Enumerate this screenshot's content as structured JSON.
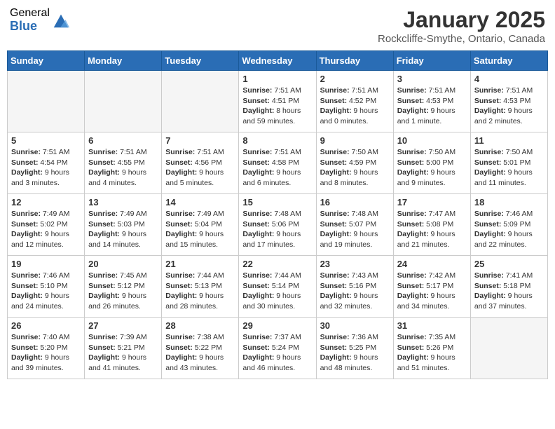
{
  "header": {
    "logo_general": "General",
    "logo_blue": "Blue",
    "title": "January 2025",
    "subtitle": "Rockcliffe-Smythe, Ontario, Canada"
  },
  "days_of_week": [
    "Sunday",
    "Monday",
    "Tuesday",
    "Wednesday",
    "Thursday",
    "Friday",
    "Saturday"
  ],
  "weeks": [
    [
      {
        "day": "",
        "info": ""
      },
      {
        "day": "",
        "info": ""
      },
      {
        "day": "",
        "info": ""
      },
      {
        "day": "1",
        "info": "Sunrise: 7:51 AM\nSunset: 4:51 PM\nDaylight: 8 hours and 59 minutes."
      },
      {
        "day": "2",
        "info": "Sunrise: 7:51 AM\nSunset: 4:52 PM\nDaylight: 9 hours and 0 minutes."
      },
      {
        "day": "3",
        "info": "Sunrise: 7:51 AM\nSunset: 4:53 PM\nDaylight: 9 hours and 1 minute."
      },
      {
        "day": "4",
        "info": "Sunrise: 7:51 AM\nSunset: 4:53 PM\nDaylight: 9 hours and 2 minutes."
      }
    ],
    [
      {
        "day": "5",
        "info": "Sunrise: 7:51 AM\nSunset: 4:54 PM\nDaylight: 9 hours and 3 minutes."
      },
      {
        "day": "6",
        "info": "Sunrise: 7:51 AM\nSunset: 4:55 PM\nDaylight: 9 hours and 4 minutes."
      },
      {
        "day": "7",
        "info": "Sunrise: 7:51 AM\nSunset: 4:56 PM\nDaylight: 9 hours and 5 minutes."
      },
      {
        "day": "8",
        "info": "Sunrise: 7:51 AM\nSunset: 4:58 PM\nDaylight: 9 hours and 6 minutes."
      },
      {
        "day": "9",
        "info": "Sunrise: 7:50 AM\nSunset: 4:59 PM\nDaylight: 9 hours and 8 minutes."
      },
      {
        "day": "10",
        "info": "Sunrise: 7:50 AM\nSunset: 5:00 PM\nDaylight: 9 hours and 9 minutes."
      },
      {
        "day": "11",
        "info": "Sunrise: 7:50 AM\nSunset: 5:01 PM\nDaylight: 9 hours and 11 minutes."
      }
    ],
    [
      {
        "day": "12",
        "info": "Sunrise: 7:49 AM\nSunset: 5:02 PM\nDaylight: 9 hours and 12 minutes."
      },
      {
        "day": "13",
        "info": "Sunrise: 7:49 AM\nSunset: 5:03 PM\nDaylight: 9 hours and 14 minutes."
      },
      {
        "day": "14",
        "info": "Sunrise: 7:49 AM\nSunset: 5:04 PM\nDaylight: 9 hours and 15 minutes."
      },
      {
        "day": "15",
        "info": "Sunrise: 7:48 AM\nSunset: 5:06 PM\nDaylight: 9 hours and 17 minutes."
      },
      {
        "day": "16",
        "info": "Sunrise: 7:48 AM\nSunset: 5:07 PM\nDaylight: 9 hours and 19 minutes."
      },
      {
        "day": "17",
        "info": "Sunrise: 7:47 AM\nSunset: 5:08 PM\nDaylight: 9 hours and 21 minutes."
      },
      {
        "day": "18",
        "info": "Sunrise: 7:46 AM\nSunset: 5:09 PM\nDaylight: 9 hours and 22 minutes."
      }
    ],
    [
      {
        "day": "19",
        "info": "Sunrise: 7:46 AM\nSunset: 5:10 PM\nDaylight: 9 hours and 24 minutes."
      },
      {
        "day": "20",
        "info": "Sunrise: 7:45 AM\nSunset: 5:12 PM\nDaylight: 9 hours and 26 minutes."
      },
      {
        "day": "21",
        "info": "Sunrise: 7:44 AM\nSunset: 5:13 PM\nDaylight: 9 hours and 28 minutes."
      },
      {
        "day": "22",
        "info": "Sunrise: 7:44 AM\nSunset: 5:14 PM\nDaylight: 9 hours and 30 minutes."
      },
      {
        "day": "23",
        "info": "Sunrise: 7:43 AM\nSunset: 5:16 PM\nDaylight: 9 hours and 32 minutes."
      },
      {
        "day": "24",
        "info": "Sunrise: 7:42 AM\nSunset: 5:17 PM\nDaylight: 9 hours and 34 minutes."
      },
      {
        "day": "25",
        "info": "Sunrise: 7:41 AM\nSunset: 5:18 PM\nDaylight: 9 hours and 37 minutes."
      }
    ],
    [
      {
        "day": "26",
        "info": "Sunrise: 7:40 AM\nSunset: 5:20 PM\nDaylight: 9 hours and 39 minutes."
      },
      {
        "day": "27",
        "info": "Sunrise: 7:39 AM\nSunset: 5:21 PM\nDaylight: 9 hours and 41 minutes."
      },
      {
        "day": "28",
        "info": "Sunrise: 7:38 AM\nSunset: 5:22 PM\nDaylight: 9 hours and 43 minutes."
      },
      {
        "day": "29",
        "info": "Sunrise: 7:37 AM\nSunset: 5:24 PM\nDaylight: 9 hours and 46 minutes."
      },
      {
        "day": "30",
        "info": "Sunrise: 7:36 AM\nSunset: 5:25 PM\nDaylight: 9 hours and 48 minutes."
      },
      {
        "day": "31",
        "info": "Sunrise: 7:35 AM\nSunset: 5:26 PM\nDaylight: 9 hours and 51 minutes."
      },
      {
        "day": "",
        "info": ""
      }
    ]
  ]
}
